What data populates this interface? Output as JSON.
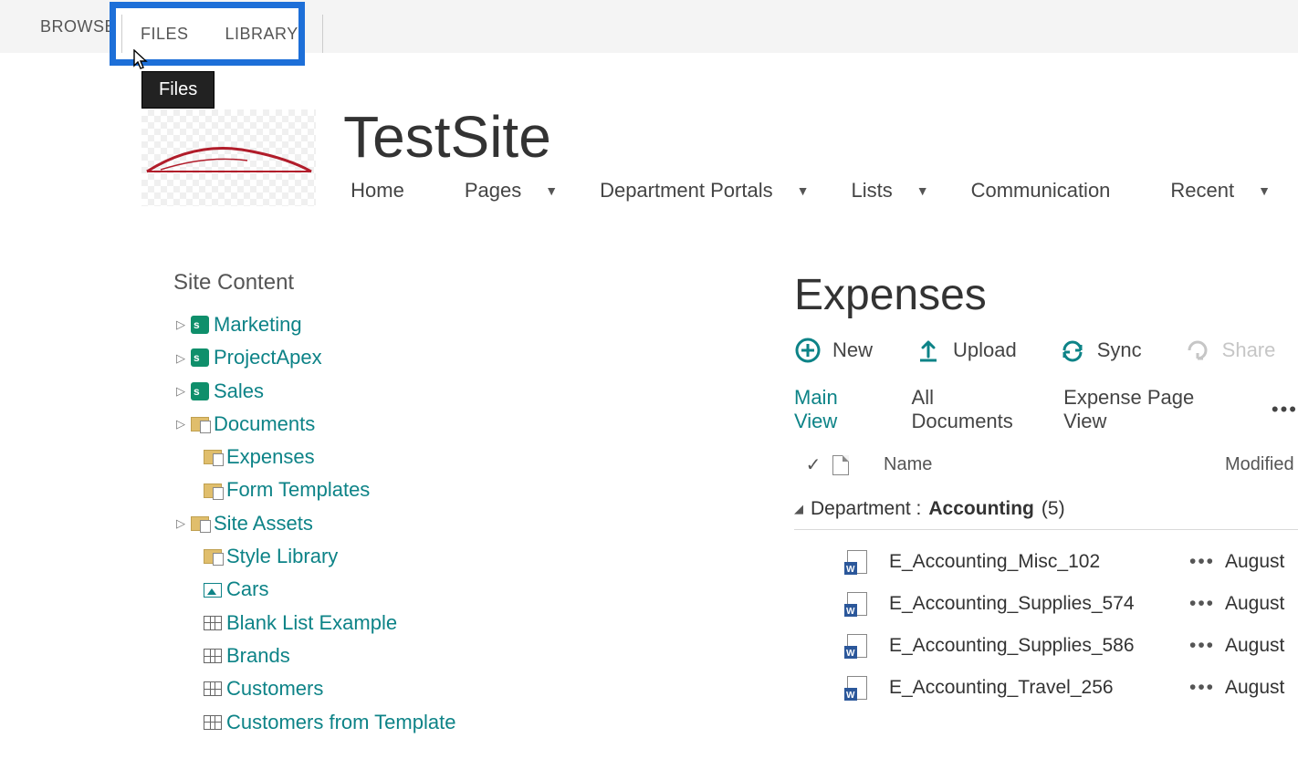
{
  "ribbon": {
    "browse": "BROWSE",
    "files": "FILES",
    "library": "LIBRARY",
    "tooltip": "Files"
  },
  "site": {
    "title": "TestSite"
  },
  "nav": {
    "home": "Home",
    "pages": "Pages",
    "dept": "Department Portals",
    "lists": "Lists",
    "comm": "Communication",
    "recent": "Recent"
  },
  "tree": {
    "header": "Site Content",
    "items": [
      {
        "label": "Marketing",
        "icon": "site",
        "expandable": true
      },
      {
        "label": "ProjectApex",
        "icon": "site",
        "expandable": true
      },
      {
        "label": "Sales",
        "icon": "site",
        "expandable": true
      },
      {
        "label": "Documents",
        "icon": "lib",
        "expandable": true
      },
      {
        "label": "Expenses",
        "icon": "lib",
        "expandable": false
      },
      {
        "label": "Form Templates",
        "icon": "lib",
        "expandable": false
      },
      {
        "label": "Site Assets",
        "icon": "lib",
        "expandable": true
      },
      {
        "label": "Style Library",
        "icon": "lib",
        "expandable": false
      },
      {
        "label": "Cars",
        "icon": "pic",
        "expandable": false
      },
      {
        "label": "Blank List Example",
        "icon": "list",
        "expandable": false
      },
      {
        "label": "Brands",
        "icon": "list",
        "expandable": false
      },
      {
        "label": "Customers",
        "icon": "list",
        "expandable": false
      },
      {
        "label": "Customers from Template",
        "icon": "list",
        "expandable": false
      }
    ]
  },
  "library": {
    "title": "Expenses",
    "toolbar": {
      "new": "New",
      "upload": "Upload",
      "sync": "Sync",
      "share": "Share"
    },
    "views": {
      "main": "Main View",
      "all": "All Documents",
      "expense": "Expense Page View",
      "more": "•••"
    },
    "columns": {
      "check": "✓",
      "name": "Name",
      "modified": "Modified"
    },
    "group": {
      "label": "Department :",
      "value": "Accounting",
      "count": "(5)"
    },
    "files": [
      {
        "name": "E_Accounting_Misc_102",
        "modified": "August"
      },
      {
        "name": "E_Accounting_Supplies_574",
        "modified": "August"
      },
      {
        "name": "E_Accounting_Supplies_586",
        "modified": "August"
      },
      {
        "name": "E_Accounting_Travel_256",
        "modified": "August"
      }
    ],
    "ellipsis": "•••"
  }
}
